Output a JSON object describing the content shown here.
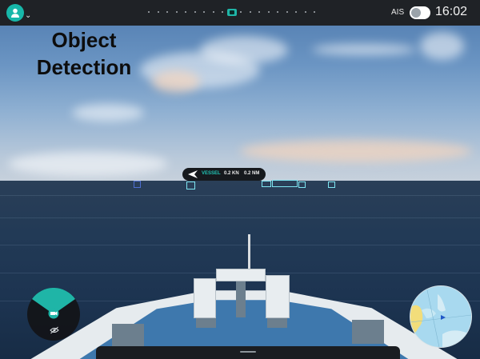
{
  "header": {
    "user_avatar_icon": "user-icon",
    "chevron_icon": "chevron-down-icon",
    "ais_label": "AIS",
    "ais_enabled": false,
    "time": "16:02",
    "pages": {
      "count": 19,
      "active_index": 9
    }
  },
  "overlay": {
    "title_line1": "Object",
    "title_line2": "Detection"
  },
  "detections": {
    "tag": {
      "direction_icon": "heading-arrow-icon",
      "type": "VESSEL",
      "speed": "0.2 KN",
      "distance": "0.2 NM"
    }
  },
  "widgets": {
    "fov_icon": "camera-icon",
    "visibility_icon": "eye-off-icon",
    "minimap_icon": "minimap-icon"
  },
  "colors": {
    "accent": "#1fb5a7",
    "topbar": "#1f2226",
    "detection_box": "#7fe6f2"
  }
}
